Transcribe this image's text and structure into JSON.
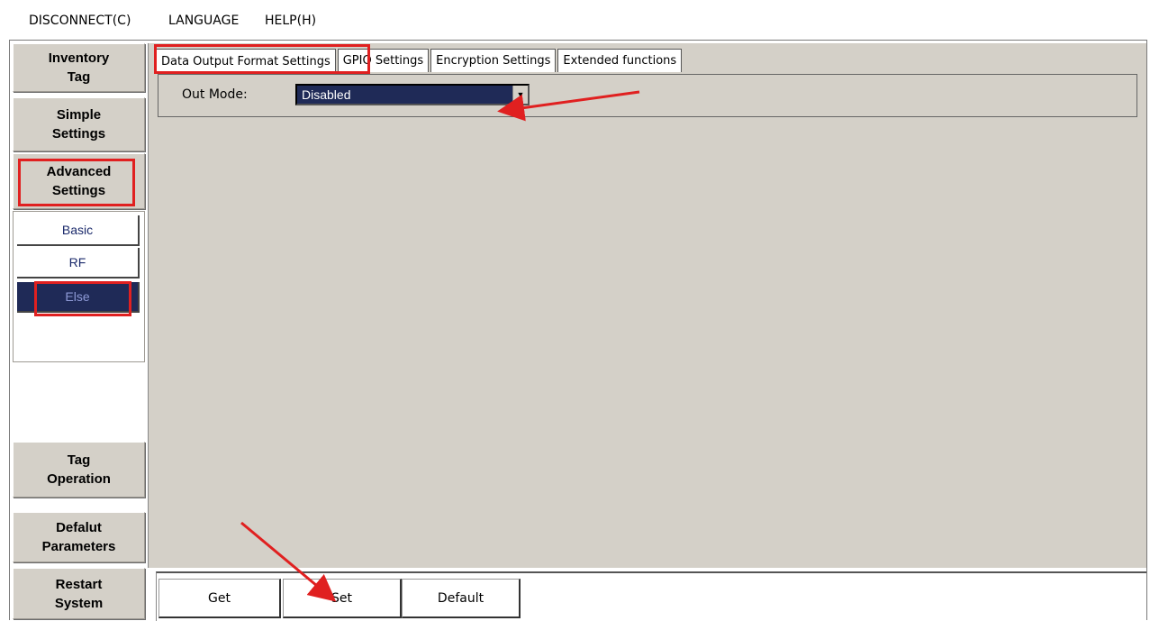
{
  "menu": {
    "disconnect": "DISCONNECT(C)",
    "language": "LANGUAGE",
    "help": "HELP(H)"
  },
  "sidebar": {
    "inventory": "Inventory\nTag",
    "simple": "Simple\nSettings",
    "advanced": "Advanced\nSettings",
    "sub_items": [
      "Basic",
      "RF",
      "Else"
    ],
    "active_sub_item": "Else",
    "tag_operation": "Tag\nOperation",
    "default_params": "Defalut\nParameters",
    "restart": "Restart\nSystem"
  },
  "tabs": [
    {
      "label": "Data Output Format Settings",
      "active": true
    },
    {
      "label": "GPIO Settings",
      "active": false
    },
    {
      "label": "Encryption Settings",
      "active": false
    },
    {
      "label": "Extended functions",
      "active": false
    }
  ],
  "out_mode": {
    "label": "Out Mode:",
    "value": "Disabled"
  },
  "buttons": {
    "get": "Get",
    "set": "Set",
    "default": "Default"
  },
  "colors": {
    "annotation": "#e02020",
    "panel_bg": "#d4d0c8",
    "selected_bg": "#1f2a57"
  }
}
